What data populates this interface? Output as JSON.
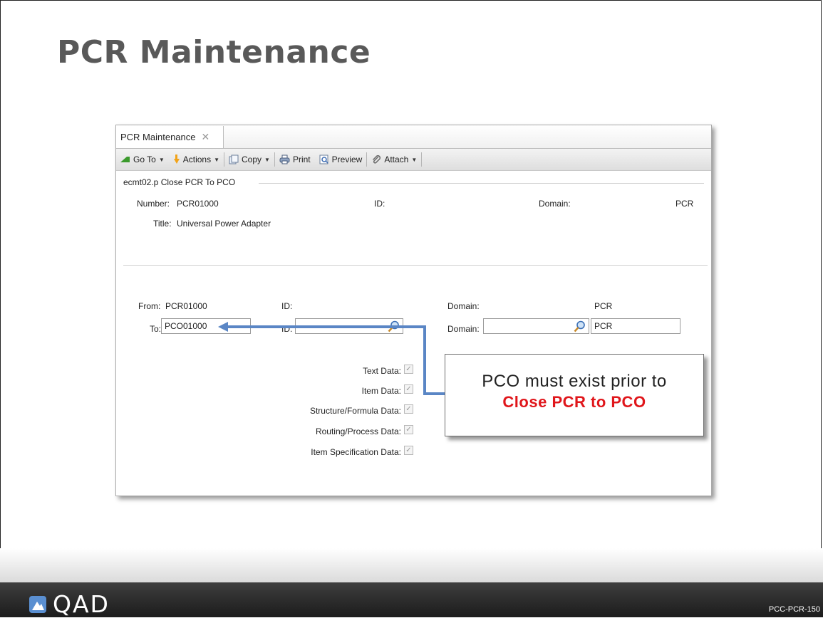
{
  "slide": {
    "title": "PCR Maintenance",
    "footer_code": "PCC-PCR-150",
    "logo_text": "QAD"
  },
  "window": {
    "tab_label": "PCR Maintenance",
    "tab_close": "✕",
    "toolbar": {
      "goto": "Go To",
      "actions": "Actions",
      "copy": "Copy",
      "print": "Print",
      "preview": "Preview",
      "attach": "Attach"
    },
    "group_title": "ecmt02.p  Close PCR To PCO",
    "header": {
      "number_label": "Number:",
      "number_value": "PCR01000",
      "id_label": "ID:",
      "domain_label": "Domain:",
      "domain_value": "PCR",
      "title_label": "Title:",
      "title_value": "Universal Power Adapter"
    },
    "form": {
      "from_label": "From:",
      "from_value": "PCR01000",
      "from_id_label": "ID:",
      "from_domain_label": "Domain:",
      "from_domain_value": "PCR",
      "to_label": "To:",
      "to_value": "PCO01000",
      "to_id_label": "ID:",
      "to_id_value": "",
      "to_domain_label": "Domain:",
      "to_domain_value": "",
      "to_domain_code": "PCR"
    },
    "checkboxes": [
      {
        "label": "Text Data:",
        "checked": true
      },
      {
        "label": "Item Data:",
        "checked": true
      },
      {
        "label": "Structure/Formula Data:",
        "checked": true
      },
      {
        "label": "Routing/Process Data:",
        "checked": true
      },
      {
        "label": "Item Specification Data:",
        "checked": true
      }
    ]
  },
  "callout": {
    "line1": "PCO must exist prior to",
    "line2": "Close PCR to PCO"
  },
  "colors": {
    "callout_highlight": "#e0161b",
    "arrow": "#5a86c5"
  }
}
